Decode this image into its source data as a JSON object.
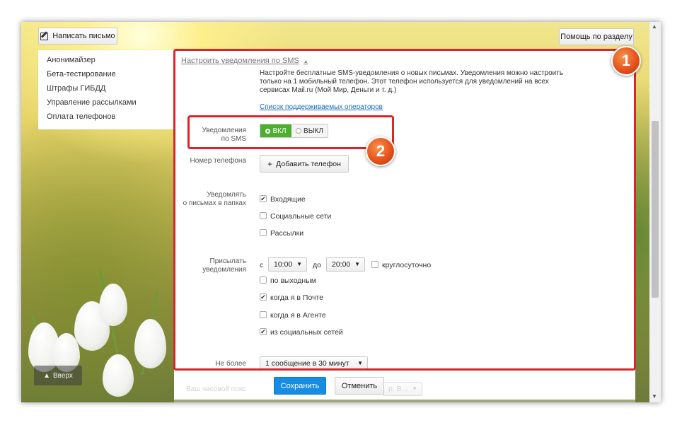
{
  "header": {
    "compose_label": "Написать письмо",
    "help_label": "Помощь по разделу"
  },
  "sidebar": {
    "items": [
      {
        "label": "Анонимайзер"
      },
      {
        "label": "Бета-тестирование"
      },
      {
        "label": "Штрафы ГИБДД"
      },
      {
        "label": "Управление рассылками"
      },
      {
        "label": "Оплата телефонов"
      }
    ],
    "up_label": "Вверх"
  },
  "sms": {
    "section_title": "Настроить уведомления по SMS",
    "description": "Настройте бесплатные SMS-уведомления о новых письмах. Уведомления можно настроить только на 1 мобильный телефон. Этот телефон используется для уведомлений на всех сервисах Mail.ru (Мой Мир, Деньги и т. д.)",
    "operators_link": "Список поддерживаемых операторов",
    "notify_label_1": "Уведомления",
    "notify_label_2": "по SMS",
    "toggle_on": "ВКЛ",
    "toggle_off": "ВЫКЛ",
    "phone_label": "Номер телефона",
    "add_phone": "Добавить телефон",
    "folders_label_1": "Уведомлять",
    "folders_label_2": "о письмах в папках",
    "folders": [
      {
        "label": "Входящие",
        "checked": true
      },
      {
        "label": "Социальные сети",
        "checked": false
      },
      {
        "label": "Рассылки",
        "checked": false
      }
    ],
    "send_label_1": "Присылать",
    "send_label_2": "уведомления",
    "from_prefix": "с",
    "from_time": "10:00",
    "to_prefix": "до",
    "to_time": "20:00",
    "round_clock": "круглосуточно",
    "options": [
      {
        "label": "по выходным",
        "checked": false
      },
      {
        "label": "когда я в Почте",
        "checked": true
      },
      {
        "label": "когда я в Агенте",
        "checked": false
      },
      {
        "label": "из социальных сетей",
        "checked": true
      }
    ],
    "limit_label": "Не более",
    "limit_value": "1 сообщение в 30 минут",
    "timezone_label": "Ваш часовой пояс",
    "timezone_value": "р. В...",
    "save_label": "Сохранить",
    "cancel_label": "Отменить"
  },
  "annotations": {
    "badge1": "1",
    "badge2": "2"
  },
  "colors": {
    "accent_green": "#4caf2d",
    "save_blue": "#168de2",
    "annotation_red": "#d8262b",
    "link_blue": "#1a6ab8"
  }
}
